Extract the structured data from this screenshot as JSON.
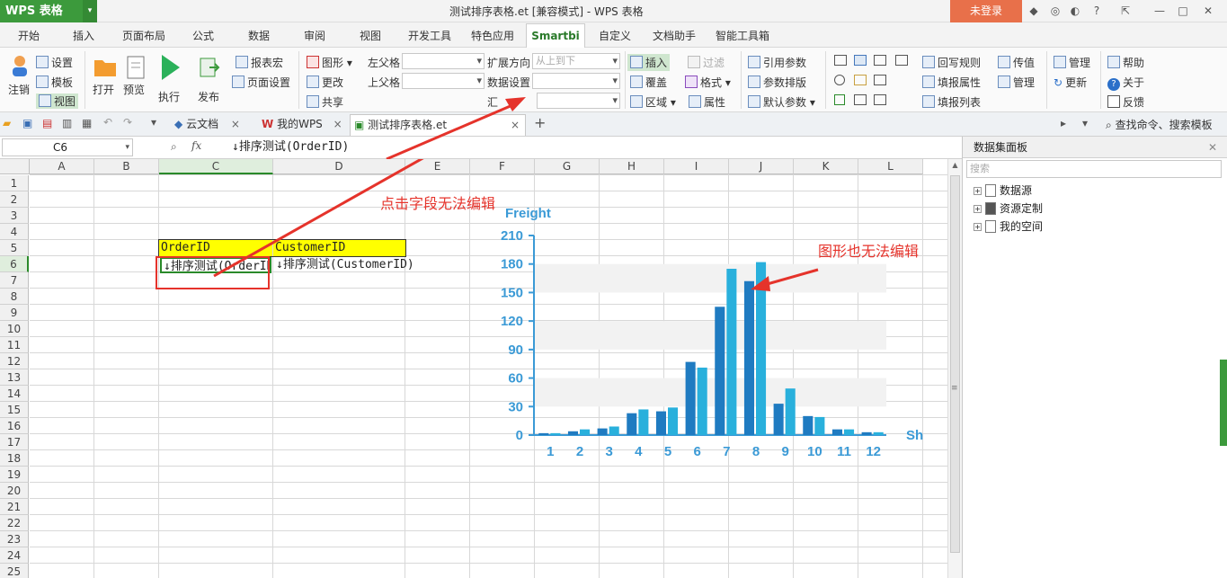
{
  "app": {
    "logo": "WPS 表格",
    "window_title": "测试排序表格.et [兼容模式] - WPS 表格",
    "login": "未登录"
  },
  "menu": [
    "开始",
    "插入",
    "页面布局",
    "公式",
    "数据",
    "审阅",
    "视图",
    "开发工具",
    "特色应用",
    "Smartbi",
    "自定义",
    "文档助手",
    "智能工具箱"
  ],
  "ribbon": {
    "setting": "设置",
    "template": "模板",
    "view": "视图",
    "logout": "注销",
    "open": "打开",
    "preview": "预览",
    "execute": "执行",
    "publish": "发布",
    "report_macro": "报表宏",
    "page_setup": "页面设置",
    "chart": "图形",
    "change": "更改",
    "share": "共享",
    "left_parent": "左父格",
    "up_parent": "上父格",
    "expand_dir": "扩展方向",
    "expand_dir_value": "从上到下",
    "data_setting": "数据设置",
    "summary": "汇",
    "insert": "插入",
    "cover": "覆盖",
    "region": "区域",
    "filter": "过滤",
    "format": "格式",
    "attribute": "属性",
    "ref_param": "引用参数",
    "param_layout": "参数排版",
    "default_param": "默认参数",
    "writeback_rule": "回写规则",
    "fill_attr": "填报属性",
    "fill_list": "填报列表",
    "pass_value": "传值",
    "manage": "管理",
    "manage2": "管理",
    "update": "更新",
    "help": "帮助",
    "about": "关于",
    "feedback": "反馈"
  },
  "doc_tabs": [
    "云文档",
    "我的WPS",
    "测试排序表格.et"
  ],
  "search_cmd": "查找命令、搜索模板",
  "name_box": "C6",
  "formula": "↓排序测试(OrderID)",
  "columns": [
    "A",
    "B",
    "C",
    "D",
    "E",
    "F",
    "G",
    "H",
    "I",
    "J",
    "K",
    "L"
  ],
  "rows": [
    "1",
    "2",
    "3",
    "4",
    "5",
    "6",
    "7",
    "8",
    "9",
    "10",
    "11",
    "12",
    "13",
    "14",
    "15",
    "16",
    "17",
    "18",
    "19",
    "20",
    "21",
    "22",
    "23",
    "24",
    "25"
  ],
  "cells": {
    "c5": "OrderID",
    "d5": "CustomerID",
    "c6": "↓排序测试(OrderID)",
    "d6": "↓排序测试(CustomerID)"
  },
  "panel": {
    "title": "数据集面板",
    "search_placeholder": "搜索",
    "tree": [
      "数据源",
      "资源定制",
      "我的空间"
    ]
  },
  "annotations": {
    "field_note": "点击字段无法编辑",
    "chart_note": "图形也无法编辑"
  },
  "colors": {
    "accent": "#3c9a3c",
    "login": "#e8704a",
    "bar_dark": "#1f7bc1",
    "bar_light": "#29b0dc",
    "note": "#e5332b",
    "header_fill": "#ffff00"
  },
  "chart_data": {
    "type": "bar",
    "ylabel": "Freight",
    "xlabel": "Sh",
    "ylim": [
      0,
      210
    ],
    "yticks": [
      0,
      30,
      60,
      90,
      120,
      150,
      180,
      210
    ],
    "categories": [
      "1",
      "2",
      "3",
      "4",
      "5",
      "6",
      "7",
      "8",
      "9",
      "10",
      "11",
      "12"
    ],
    "series": [
      {
        "values": [
          2,
          4,
          7,
          23,
          25,
          77,
          135,
          162,
          33,
          20,
          6,
          3
        ]
      },
      {
        "values": [
          2,
          6,
          9,
          27,
          29,
          71,
          175,
          182,
          49,
          19,
          6,
          3
        ]
      }
    ]
  }
}
